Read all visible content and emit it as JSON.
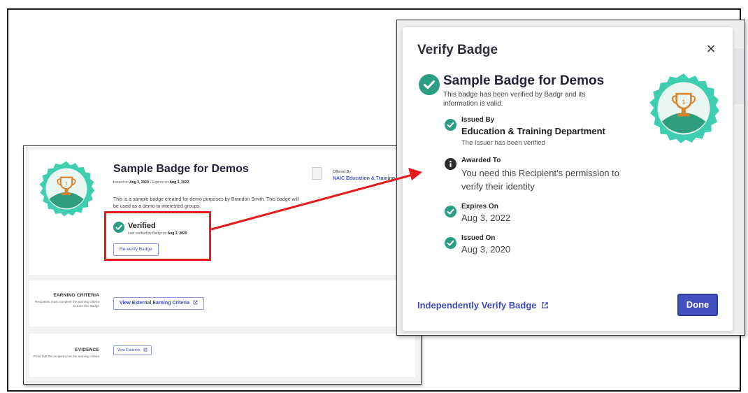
{
  "badge_page": {
    "title": "Sample Badge for Demos",
    "issued_prefix": "Issued on",
    "issued_date": "Aug 3, 2020",
    "date_separator": "•",
    "expires_prefix": "Expires on",
    "expires_date": "Aug 3, 2022",
    "description": "This is a sample badge created for demo purposes by Brandon Smith. This badge will be used as a demo to interested groups.",
    "offered_by_label": "Offered By",
    "offered_by_org": "NAIC Education & Training Department",
    "verified_label": "Verified",
    "last_verified_prefix": "Last verified by Badgr on",
    "last_verified_date": "Aug 3, 2020",
    "reverify_button": "Re-verify Badge",
    "earning_criteria_title": "EARNING CRITERIA",
    "earning_criteria_desc": "Recipients must complete the earning criteria to earn this Badge",
    "earning_criteria_button": "View External Earning Criteria",
    "evidence_title": "EVIDENCE",
    "evidence_desc": "Proof that the recipient met the earning criteria",
    "evidence_button": "View Evidence"
  },
  "modal": {
    "title": "Verify Badge",
    "badge_name": "Sample Badge for Demos",
    "verified_text": "This badge has been verified by Badgr and its information is valid.",
    "issued_by_label": "Issued By",
    "issued_by_value": "Education & Training Department",
    "issued_by_note": "The Issuer has been verified",
    "awarded_to_label": "Awarded To",
    "awarded_to_value": "You need this Recipient's permission to verify their identity",
    "expires_label": "Expires On",
    "expires_value": "Aug 3, 2022",
    "issued_on_label": "Issued On",
    "issued_on_value": "Aug 3, 2020",
    "independent_link": "Independently Verify Badge",
    "done_button": "Done"
  },
  "icons": {
    "verified": "check-circle-icon",
    "awarded": "info-icon",
    "close": "close-icon",
    "external": "external-link-icon",
    "badge": "trophy-badge-image"
  },
  "colors": {
    "accent": "#434fbf",
    "link": "#3f4bb5",
    "verified_green": "#2a9d84",
    "badge_teal": "#3fcfb0",
    "highlight_red": "#e41b1b"
  }
}
